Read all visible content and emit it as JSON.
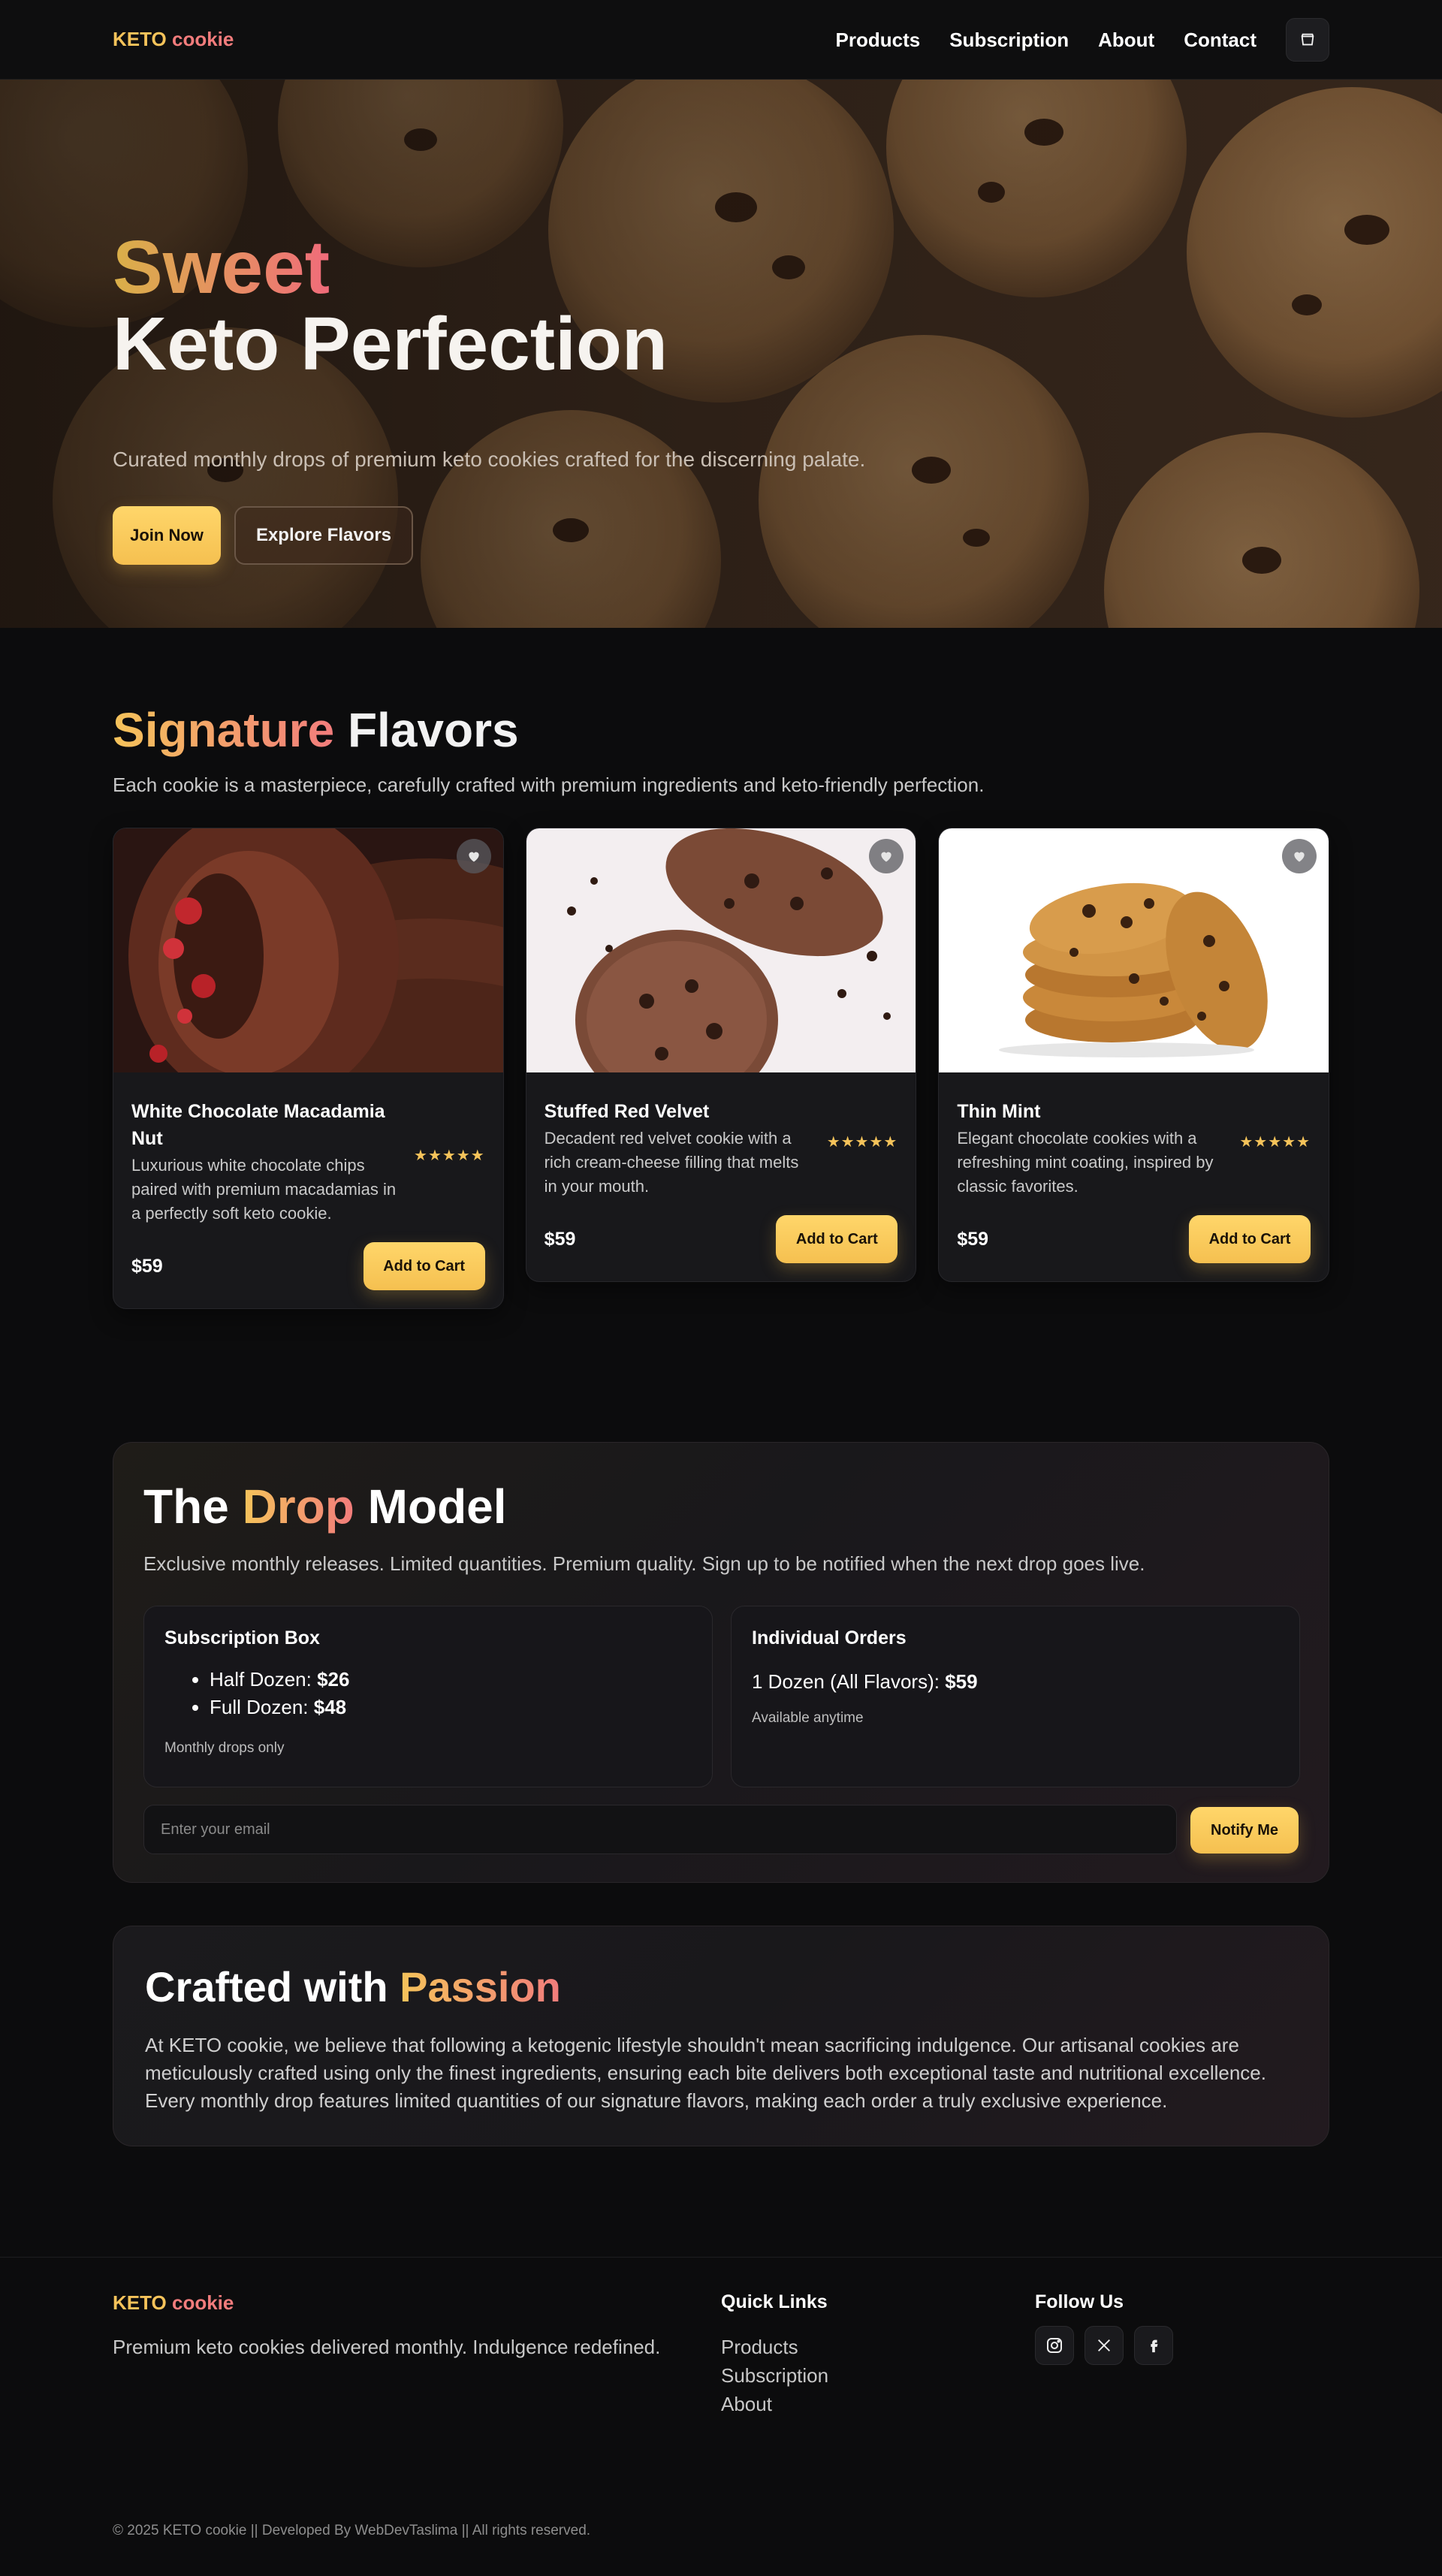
{
  "brand": {
    "name_part1": "KETO",
    "name_part2": "cookie"
  },
  "nav": {
    "items": [
      {
        "label": "Products"
      },
      {
        "label": "Subscription"
      },
      {
        "label": "About"
      },
      {
        "label": "Contact"
      }
    ],
    "cart_icon": "shopping-bag-icon"
  },
  "hero": {
    "title_line1": "Sweet",
    "title_line2": "Keto Perfection",
    "subtitle": "Curated monthly drops of premium keto cookies crafted for the discerning palate.",
    "primary_button": "Join Now",
    "secondary_button": "Explore Flavors"
  },
  "signature": {
    "title_accent": "Signature",
    "title_rest": "Flavors",
    "subtitle": "Each cookie is a masterpiece, carefully crafted with premium ingredients and keto-friendly perfection.",
    "products": [
      {
        "name": "White Chocolate Macadamia Nut",
        "description": "Luxurious white chocolate chips paired with premium macadamias in a perfectly soft keto cookie.",
        "rating": 5,
        "stars": "★★★★★",
        "price": "$59",
        "cta": "Add to Cart"
      },
      {
        "name": "Stuffed Red Velvet",
        "description": "Decadent red velvet cookie with a rich cream-cheese filling that melts in your mouth.",
        "rating": 5,
        "stars": "★★★★★",
        "price": "$59",
        "cta": "Add to Cart"
      },
      {
        "name": "Thin Mint",
        "description": "Elegant chocolate cookies with a refreshing mint coating, inspired by classic favorites.",
        "rating": 5,
        "stars": "★★★★★",
        "price": "$59",
        "cta": "Add to Cart"
      }
    ]
  },
  "drop_model": {
    "title_pre": "The",
    "title_accent": "Drop",
    "title_post": "Model",
    "subtitle": "Exclusive monthly releases. Limited quantities. Premium quality. Sign up to be notified when the next drop goes live.",
    "subscription": {
      "title": "Subscription Box",
      "items": [
        {
          "label": "Half Dozen:",
          "price": "$26"
        },
        {
          "label": "Full Dozen:",
          "price": "$48"
        }
      ],
      "note": "Monthly drops only"
    },
    "individual": {
      "title": "Individual Orders",
      "line_label": "1 Dozen (All Flavors):",
      "line_price": "$59",
      "note": "Available anytime"
    },
    "email_placeholder": "Enter your email",
    "notify_button": "Notify Me"
  },
  "passion": {
    "title_pre": "Crafted with",
    "title_accent": "Passion",
    "body": "At KETO cookie, we believe that following a ketogenic lifestyle shouldn't mean sacrificing indulgence. Our artisanal cookies are meticulously crafted using only the finest ingredients, ensuring each bite delivers both exceptional taste and nutritional excellence. Every monthly drop features limited quantities of our signature flavors, making each order a truly exclusive experience."
  },
  "footer": {
    "tagline": "Premium keto cookies delivered monthly. Indulgence redefined.",
    "quick_links_title": "Quick Links",
    "quick_links": [
      {
        "label": "Products"
      },
      {
        "label": "Subscription"
      },
      {
        "label": "About"
      }
    ],
    "follow_title": "Follow Us",
    "socials": [
      "instagram-icon",
      "x-icon",
      "facebook-icon"
    ],
    "copyright": "© 2025 KETO cookie || Developed By WebDevTaslima || All rights reserved."
  },
  "colors": {
    "accent_yellow": "#f5c35a",
    "accent_pink": "#f27c7c",
    "background": "#0c0c0d",
    "card": "#18181b"
  }
}
